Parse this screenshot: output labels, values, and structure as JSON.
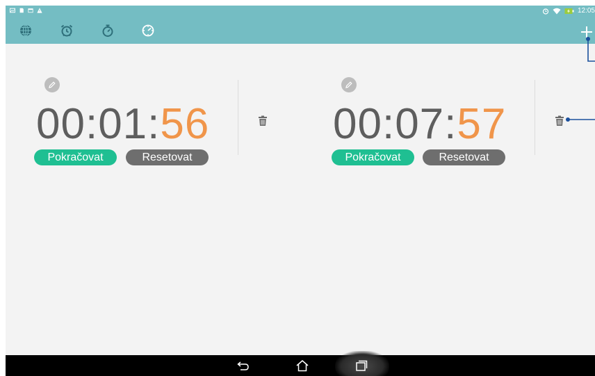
{
  "status_bar": {
    "time": "12:05",
    "left_icons": [
      "photo-icon",
      "sd-card-icon",
      "calendar-icon",
      "warning-icon"
    ],
    "right_icons": [
      "alarm-icon",
      "wifi-icon",
      "battery-charging-icon"
    ]
  },
  "tabs": [
    {
      "name": "world-clock",
      "icon": "globe-icon"
    },
    {
      "name": "alarm",
      "icon": "alarm-clock-icon"
    },
    {
      "name": "stopwatch",
      "icon": "stopwatch-icon"
    },
    {
      "name": "timer",
      "icon": "timer-icon"
    }
  ],
  "timers": [
    {
      "hours_minutes": "00:01:",
      "seconds": "56",
      "resume_label": "Pokračovat",
      "reset_label": "Resetovat"
    },
    {
      "hours_minutes": "00:07:",
      "seconds": "57",
      "resume_label": "Pokračovat",
      "reset_label": "Resetovat"
    }
  ],
  "colors": {
    "app_bar": "#74bdc3",
    "seconds_accent": "#f0954a",
    "resume_button": "#1fbf92",
    "reset_button": "#6e6e6e",
    "callout_line": "#1a4f9c"
  },
  "nav_bar": {
    "buttons": [
      "back-icon",
      "home-icon",
      "recent-apps-icon"
    ]
  }
}
